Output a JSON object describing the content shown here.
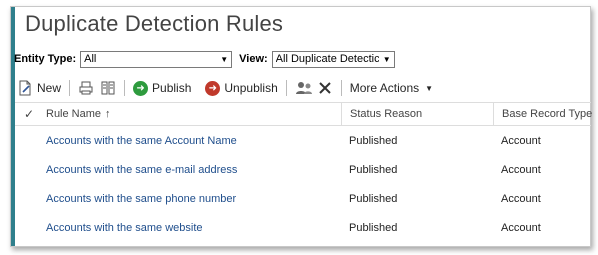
{
  "page": {
    "title": "Duplicate Detection Rules"
  },
  "filters": {
    "entity_type_label": "Entity Type:",
    "entity_type_value": "All",
    "view_label": "View:",
    "view_value": "All Duplicate Detectic"
  },
  "toolbar": {
    "new_label": "New",
    "publish_label": "Publish",
    "unpublish_label": "Unpublish",
    "more_actions_label": "More Actions"
  },
  "grid": {
    "columns": {
      "name": "Rule Name",
      "status": "Status Reason",
      "type": "Base Record Type"
    },
    "rows": [
      {
        "name": "Accounts with the same Account Name",
        "status": "Published",
        "type": "Account"
      },
      {
        "name": "Accounts with the same e-mail address",
        "status": "Published",
        "type": "Account"
      },
      {
        "name": "Accounts with the same phone number",
        "status": "Published",
        "type": "Account"
      },
      {
        "name": "Accounts with the same website",
        "status": "Published",
        "type": "Account"
      }
    ]
  },
  "colors": {
    "accent": "#2f7f8c",
    "link": "#1f4e8c",
    "publish": "#2e9b3e",
    "unpublish": "#c0392b"
  }
}
